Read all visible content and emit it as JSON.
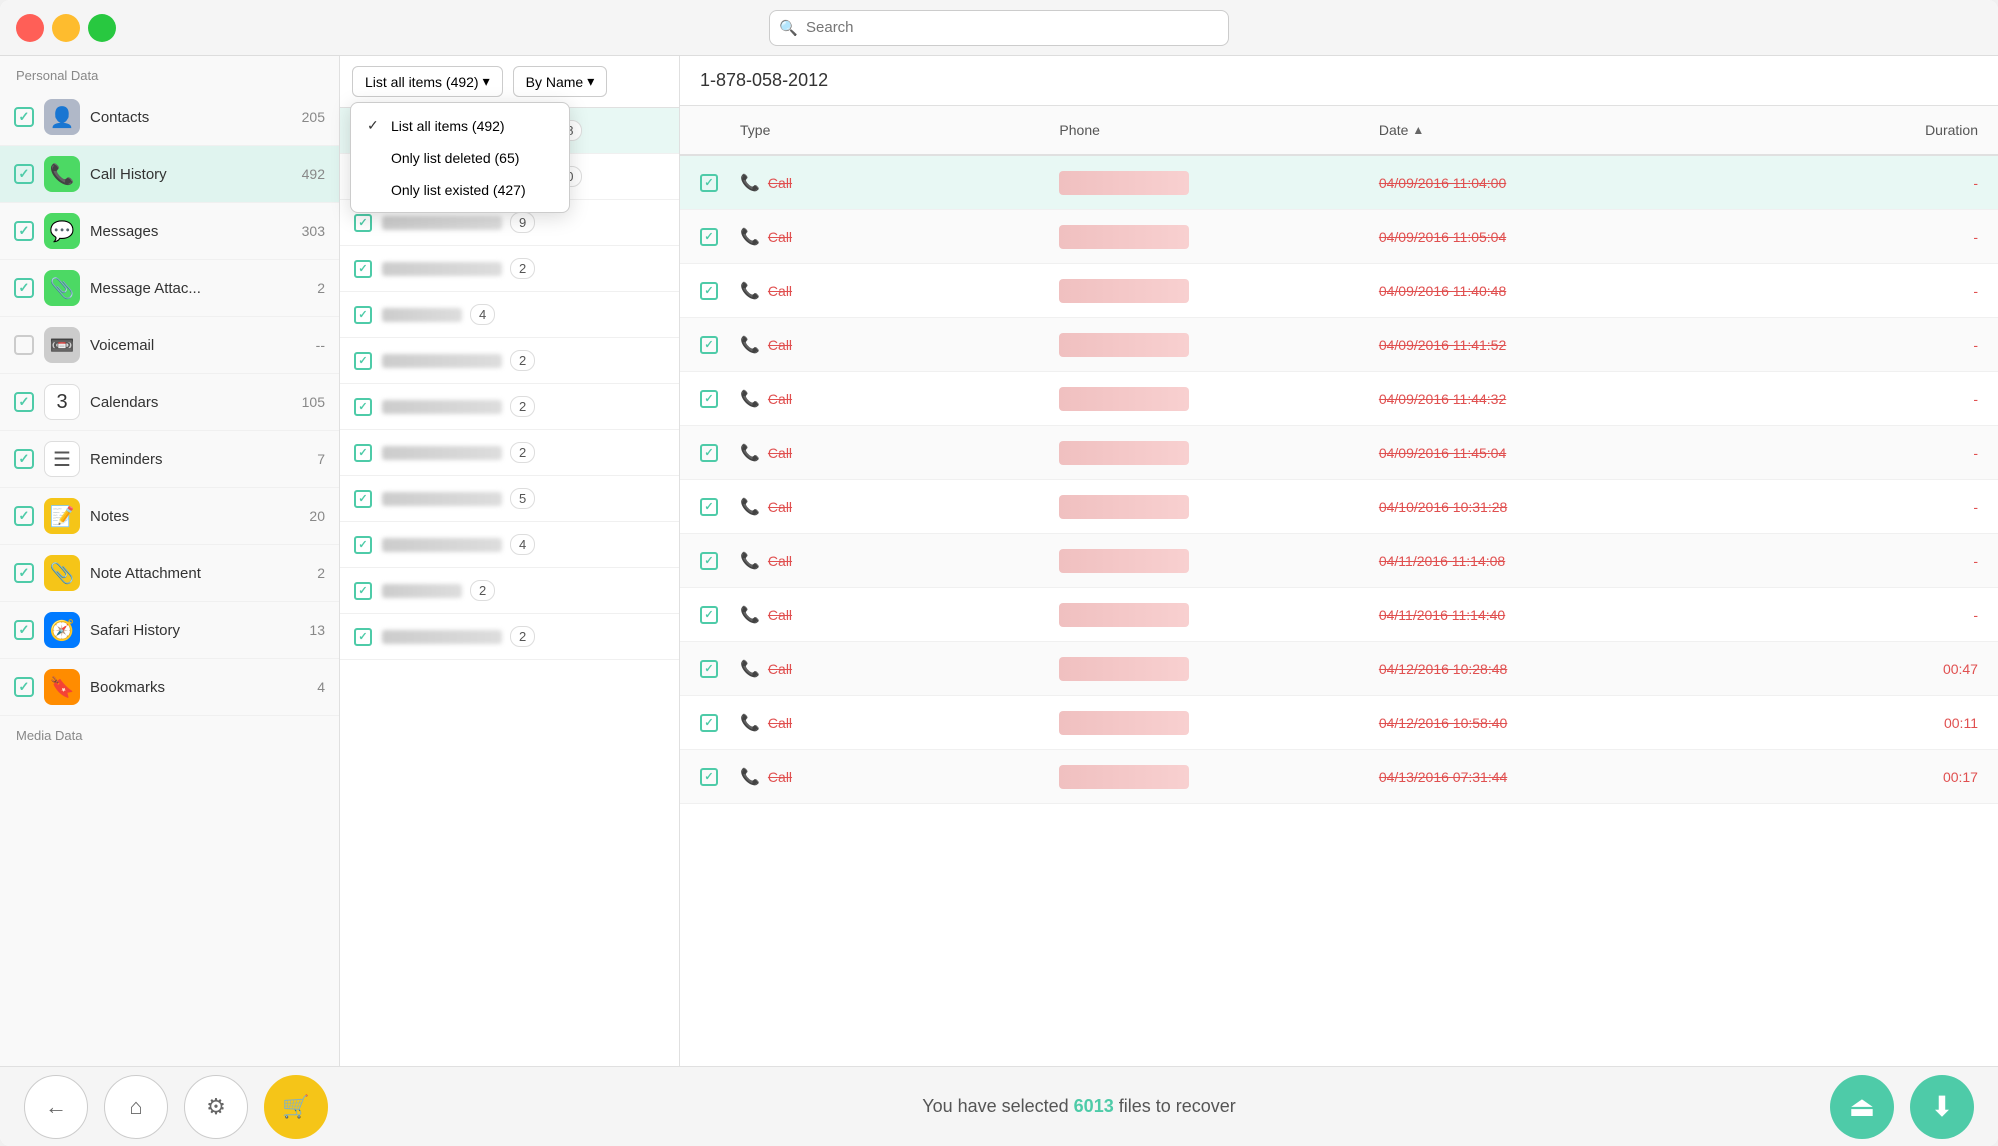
{
  "titleBar": {
    "searchPlaceholder": "Search"
  },
  "sidebar": {
    "personalLabel": "Personal Data",
    "mediaLabel": "Media Data",
    "items": [
      {
        "id": "contacts",
        "name": "Contacts",
        "count": "205",
        "checked": true,
        "icon": "👤",
        "iconClass": "icon-contacts"
      },
      {
        "id": "callhistory",
        "name": "Call History",
        "count": "492",
        "checked": true,
        "icon": "📞",
        "iconClass": "icon-callhistory",
        "active": true
      },
      {
        "id": "messages",
        "name": "Messages",
        "count": "303",
        "checked": true,
        "icon": "💬",
        "iconClass": "icon-messages"
      },
      {
        "id": "messageattach",
        "name": "Message Attac...",
        "count": "2",
        "checked": true,
        "icon": "📎",
        "iconClass": "icon-msgattach"
      },
      {
        "id": "voicemail",
        "name": "Voicemail",
        "count": "--",
        "checked": false,
        "icon": "📼",
        "iconClass": "icon-voicemail"
      },
      {
        "id": "calendars",
        "name": "Calendars",
        "count": "105",
        "checked": true,
        "icon": "3",
        "iconClass": "icon-calendars"
      },
      {
        "id": "reminders",
        "name": "Reminders",
        "count": "7",
        "checked": true,
        "icon": "☰",
        "iconClass": "icon-reminders"
      },
      {
        "id": "notes",
        "name": "Notes",
        "count": "20",
        "checked": true,
        "icon": "📝",
        "iconClass": "icon-notes"
      },
      {
        "id": "noteattachment",
        "name": "Note Attachment",
        "count": "2",
        "checked": true,
        "icon": "📎",
        "iconClass": "icon-noteattach"
      },
      {
        "id": "safarihistory",
        "name": "Safari History",
        "count": "13",
        "checked": true,
        "icon": "🧭",
        "iconClass": "icon-safari"
      },
      {
        "id": "bookmarks",
        "name": "Bookmarks",
        "count": "4",
        "checked": true,
        "icon": "🔖",
        "iconClass": "icon-bookmarks"
      }
    ]
  },
  "middlePanel": {
    "filterBtn": "List all items (492)",
    "sortBtn": "By Name",
    "dropdown": {
      "visible": true,
      "items": [
        {
          "label": "List all items (492)",
          "checked": true
        },
        {
          "label": "Only list deleted (65)",
          "checked": false
        },
        {
          "label": "Only list existed (427)",
          "checked": false
        }
      ]
    },
    "listItems": [
      {
        "count": "28",
        "blur": "long"
      },
      {
        "count": "30",
        "blur": "long"
      },
      {
        "count": "9",
        "blur": "medium"
      },
      {
        "count": "2",
        "blur": "medium"
      },
      {
        "count": "4",
        "blur": "short"
      },
      {
        "count": "2",
        "blur": "medium"
      },
      {
        "count": "2",
        "blur": "medium"
      },
      {
        "count": "2",
        "blur": "medium"
      },
      {
        "count": "5",
        "blur": "medium"
      },
      {
        "count": "4",
        "blur": "medium"
      },
      {
        "count": "2",
        "blur": "short"
      },
      {
        "count": "2",
        "blur": "medium"
      }
    ]
  },
  "rightPanel": {
    "title": "1-878-058-2012",
    "columns": {
      "type": "Type",
      "phone": "Phone",
      "date": "Date",
      "duration": "Duration"
    },
    "rows": [
      {
        "type": "Call",
        "date": "04/09/2016 11:04:00",
        "duration": "-"
      },
      {
        "type": "Call",
        "date": "04/09/2016 11:05:04",
        "duration": "-"
      },
      {
        "type": "Call",
        "date": "04/09/2016 11:40:48",
        "duration": "-"
      },
      {
        "type": "Call",
        "date": "04/09/2016 11:41:52",
        "duration": "-"
      },
      {
        "type": "Call",
        "date": "04/09/2016 11:44:32",
        "duration": "-"
      },
      {
        "type": "Call",
        "date": "04/09/2016 11:45:04",
        "duration": "-"
      },
      {
        "type": "Call",
        "date": "04/10/2016 10:31:28",
        "duration": "-"
      },
      {
        "type": "Call",
        "date": "04/11/2016 11:14:08",
        "duration": "-"
      },
      {
        "type": "Call",
        "date": "04/11/2016 11:14:40",
        "duration": "-"
      },
      {
        "type": "Call",
        "date": "04/12/2016 10:28:48",
        "duration": "00:47"
      },
      {
        "type": "Call",
        "date": "04/12/2016 10:58:40",
        "duration": "00:11"
      },
      {
        "type": "Call",
        "date": "04/13/2016 07:31:44",
        "duration": "00:17"
      }
    ]
  },
  "bottomBar": {
    "statusText": "You have selected ",
    "statusCount": "6013",
    "statusSuffix": " files to recover"
  },
  "icons": {
    "search": "🔍",
    "back": "←",
    "home": "⌂",
    "settings": "⚙",
    "cart": "🛒",
    "export1": "↑",
    "export2": "↓"
  }
}
